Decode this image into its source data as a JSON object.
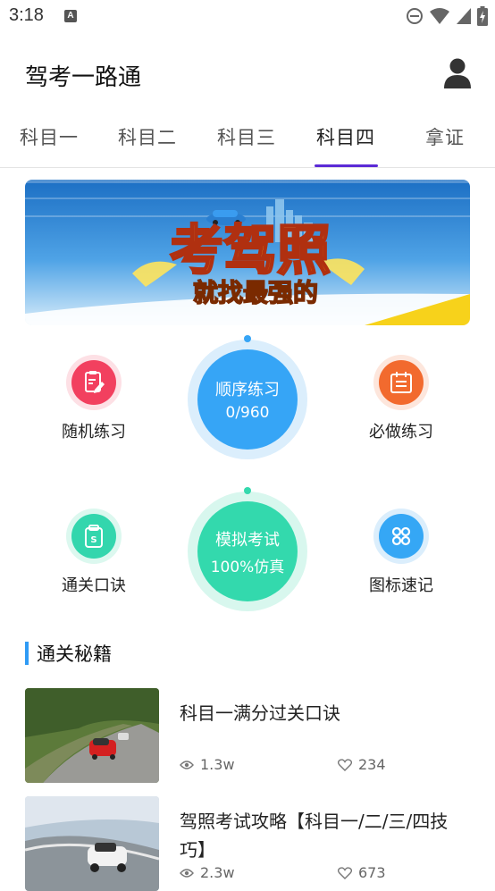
{
  "status": {
    "time": "3:18",
    "a_badge": "A"
  },
  "header": {
    "title": "驾考一路通"
  },
  "tabs": [
    {
      "label": "科目一"
    },
    {
      "label": "科目二"
    },
    {
      "label": "科目三"
    },
    {
      "label": "科目四"
    },
    {
      "label": "拿证"
    }
  ],
  "active_tab": 3,
  "banner": {
    "line1": "考驾照",
    "line2": "就找最强的"
  },
  "features": {
    "random": {
      "label": "随机练习",
      "icon": "edit-document-icon",
      "color": "#f2405f"
    },
    "sequential": {
      "line1": "顺序练习",
      "line2": "0/960",
      "color": "#36a5f6"
    },
    "must": {
      "label": "必做练习",
      "icon": "calendar-list-icon",
      "color": "#f26a2e"
    },
    "tips": {
      "label": "通关口诀",
      "icon": "clipboard-s-icon",
      "color": "#33d6ad"
    },
    "mock": {
      "line1": "模拟考试",
      "line2": "100%仿真",
      "color": "#33d9ad"
    },
    "signs": {
      "label": "图标速记",
      "icon": "command-icon",
      "color": "#35a7f5"
    }
  },
  "section": {
    "title": "通关秘籍"
  },
  "articles": [
    {
      "title": "科目一满分过关口诀",
      "views": "1.3w",
      "likes": "234"
    },
    {
      "title": "驾照考试攻略【科目一/二/三/四技巧】",
      "views": "2.3w",
      "likes": "673"
    }
  ]
}
